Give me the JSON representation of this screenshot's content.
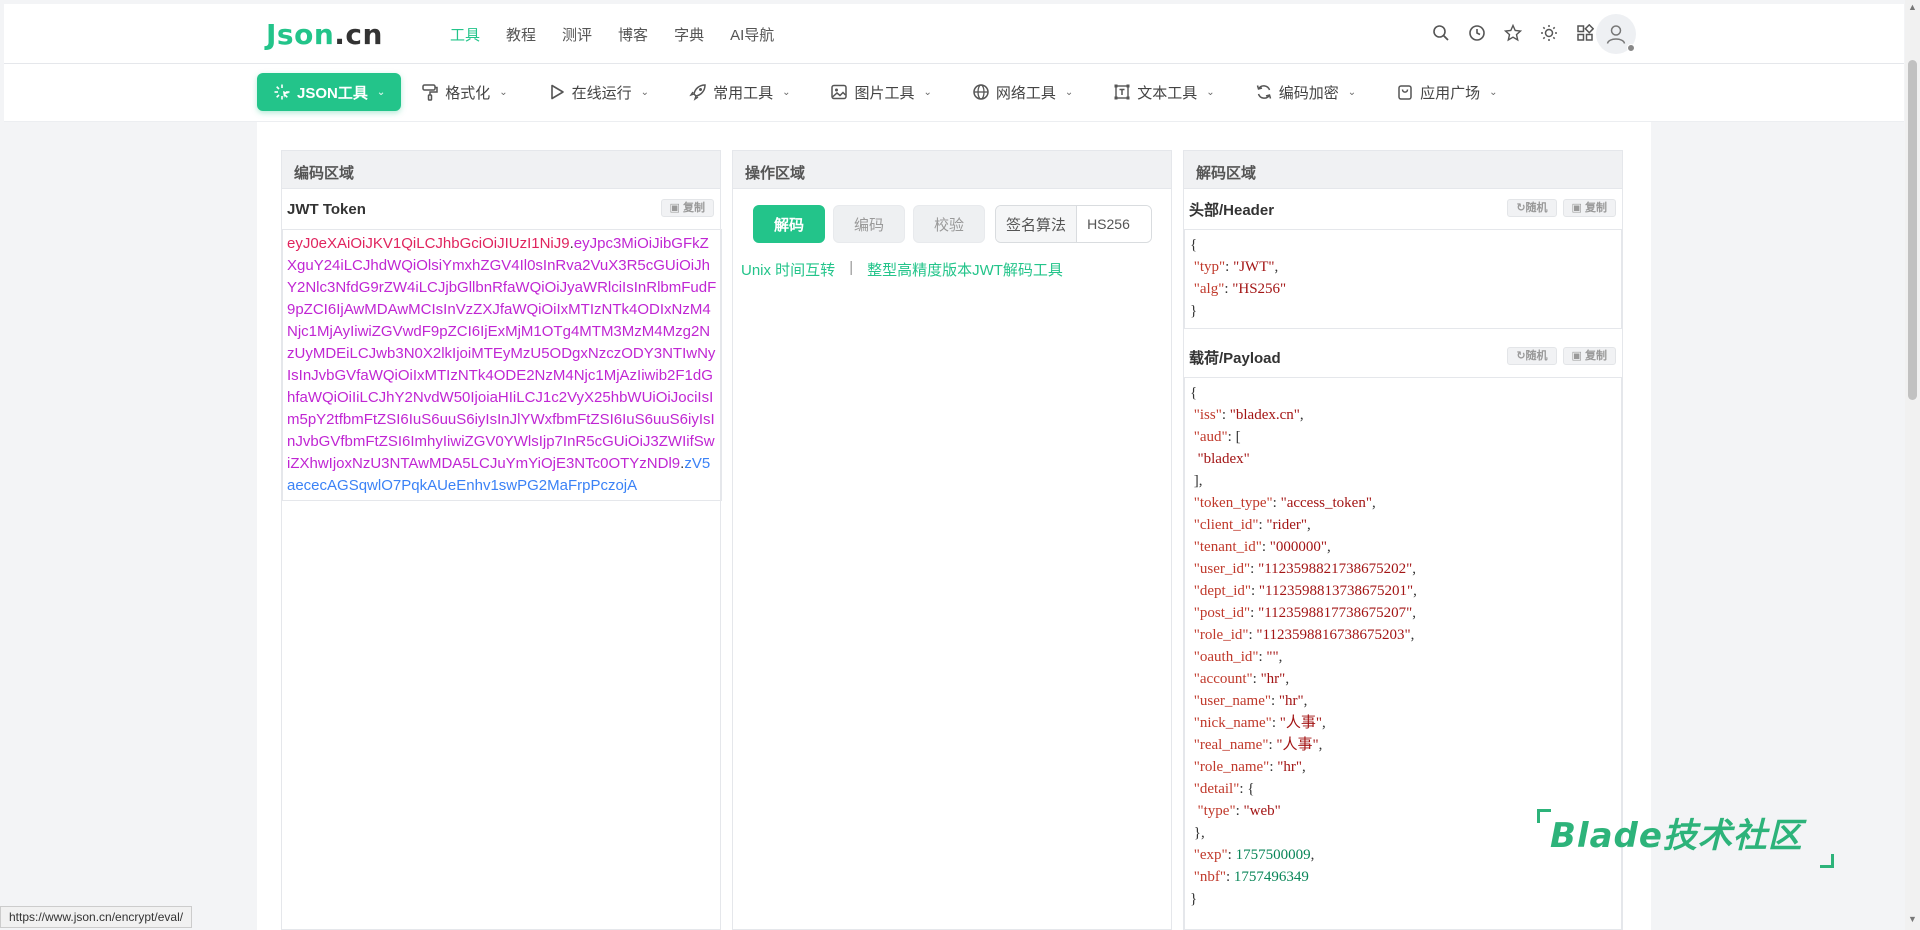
{
  "header": {
    "logo_main": "Json",
    "logo_dot": ".cn",
    "nav": [
      "工具",
      "教程",
      "测评",
      "博客",
      "字典",
      "AI导航"
    ],
    "icons": [
      "search-icon",
      "history-icon",
      "star-icon",
      "theme-icon",
      "apps-icon"
    ]
  },
  "menubar": {
    "items": [
      {
        "label": "JSON工具",
        "icon": "sparkle-icon"
      },
      {
        "label": "格式化",
        "icon": "brush-icon"
      },
      {
        "label": "在线运行",
        "icon": "play-icon"
      },
      {
        "label": "常用工具",
        "icon": "rocket-icon"
      },
      {
        "label": "图片工具",
        "icon": "image-icon"
      },
      {
        "label": "网络工具",
        "icon": "globe-icon"
      },
      {
        "label": "文本工具",
        "icon": "text-icon"
      },
      {
        "label": "编码加密",
        "icon": "refresh-icon"
      },
      {
        "label": "应用广场",
        "icon": "bag-icon"
      }
    ]
  },
  "encode_panel": {
    "title": "编码区域",
    "sub_title": "JWT Token",
    "copy_label": "复制",
    "token_header": "eyJ0eXAiOiJKV1QiLCJhbGciOiJIUzI1NiJ9",
    "token_payload": "eyJpc3MiOiJibGFkZXguY24iLCJhdWQiOlsiYmxhZGV4Il0sInRva2VuX3R5cGUiOiJhY2Nlc3NfdG9rZW4iLCJjbGllbnRfaWQiOiJyaWRlciIsInRlbmFudF9pZCI6IjAwMDAwMCIsInVzZXJfaWQiOiIxMTIzNTk4ODIxNzM4Njc1MjAyIiwiZGVwdF9pZCI6IjExMjM1OTg4MTM3MzM4Mzg2NzUyMDEiLCJwb3N0X2lkIjoiMTEyMzU5ODgxNzczODY3NTIwNyIsInJvbGVfaWQiOiIxMTIzNTk4ODE2NzM4Njc1MjAzIiwib2F1dGhfaWQiOiIiLCJhY2NvdW50IjoiaHIiLCJ1c2VyX25hbWUiOiJociIsIm5pY2tfbmFtZSI6IuS6uuS6iyIsInJlYWxfbmFtZSI6IuS6uuS6iyIsInJvbGVfbmFtZSI6ImhyIiwiZGV0YWlsIjp7InR5cGUiOiJ3ZWIifSwiZXhwIjoxNzU3NTAwMDA5LCJuYmYiOjE3NTc0OTYzNDl9",
    "token_signature": "zV5aececAGSqwlO7PqkAUeEnhv1swPG2MaFrpPczojA"
  },
  "operation_panel": {
    "title": "操作区域",
    "decode_label": "解码",
    "encode_label": "编码",
    "verify_label": "校验",
    "alg_label": "签名算法",
    "alg_value": "HS256",
    "link_unix": "Unix 时间互转",
    "link_separator": "|",
    "link_hp": "整型高精度版本JWT解码工具"
  },
  "decode_panel": {
    "title": "解码区域",
    "header_title": "头部/Header",
    "payload_title": "载荷/Payload",
    "random_label": "随机",
    "copy_label": "复制",
    "header_lines": [
      {
        "t": "{"
      },
      {
        "k": "\"typ\"",
        "v": "\"JWT\"",
        "vt": "s",
        "tail": ","
      },
      {
        "k": "\"alg\"",
        "v": "\"HS256\"",
        "vt": "s",
        "tail": ""
      },
      {
        "t": "}"
      }
    ],
    "payload_lines": [
      {
        "t": "{"
      },
      {
        "k": "\"iss\"",
        "v": "\"bladex.cn\"",
        "vt": "s",
        "tail": ","
      },
      {
        "k": "\"aud\"",
        "v": "[",
        "vt": "p",
        "tail": ""
      },
      {
        "t": "  \"bladex\"",
        "cls": "s"
      },
      {
        "t": " ],"
      },
      {
        "k": "\"token_type\"",
        "v": "\"access_token\"",
        "vt": "s",
        "tail": ","
      },
      {
        "k": "\"client_id\"",
        "v": "\"rider\"",
        "vt": "s",
        "tail": ","
      },
      {
        "k": "\"tenant_id\"",
        "v": "\"000000\"",
        "vt": "s",
        "tail": ","
      },
      {
        "k": "\"user_id\"",
        "v": "\"1123598821738675202\"",
        "vt": "s",
        "tail": ","
      },
      {
        "k": "\"dept_id\"",
        "v": "\"1123598813738675201\"",
        "vt": "s",
        "tail": ","
      },
      {
        "k": "\"post_id\"",
        "v": "\"1123598817738675207\"",
        "vt": "s",
        "tail": ","
      },
      {
        "k": "\"role_id\"",
        "v": "\"1123598816738675203\"",
        "vt": "s",
        "tail": ","
      },
      {
        "k": "\"oauth_id\"",
        "v": "\"\"",
        "vt": "s",
        "tail": ","
      },
      {
        "k": "\"account\"",
        "v": "\"hr\"",
        "vt": "s",
        "tail": ","
      },
      {
        "k": "\"user_name\"",
        "v": "\"hr\"",
        "vt": "s",
        "tail": ","
      },
      {
        "k": "\"nick_name\"",
        "v": "\"人事\"",
        "vt": "s",
        "tail": ","
      },
      {
        "k": "\"real_name\"",
        "v": "\"人事\"",
        "vt": "s",
        "tail": ","
      },
      {
        "k": "\"role_name\"",
        "v": "\"hr\"",
        "vt": "s",
        "tail": ","
      },
      {
        "k": "\"detail\"",
        "v": "{",
        "vt": "p",
        "tail": ""
      },
      {
        "t": "  \"type\": \"web\"",
        "cls": "kv"
      },
      {
        "t": " },"
      },
      {
        "k": "\"exp\"",
        "v": "1757500009",
        "vt": "n",
        "tail": ","
      },
      {
        "k": "\"nbf\"",
        "v": "1757496349",
        "vt": "n",
        "tail": ""
      },
      {
        "t": "}"
      }
    ]
  },
  "watermark": "Blade技术社区",
  "status_url": "https://www.json.cn/encrypt/eval/",
  "colors": {
    "accent": "#23c48a",
    "jwt_header": "#e0245e",
    "jwt_payload": "#c026d3",
    "jwt_signature": "#3b82f6"
  }
}
